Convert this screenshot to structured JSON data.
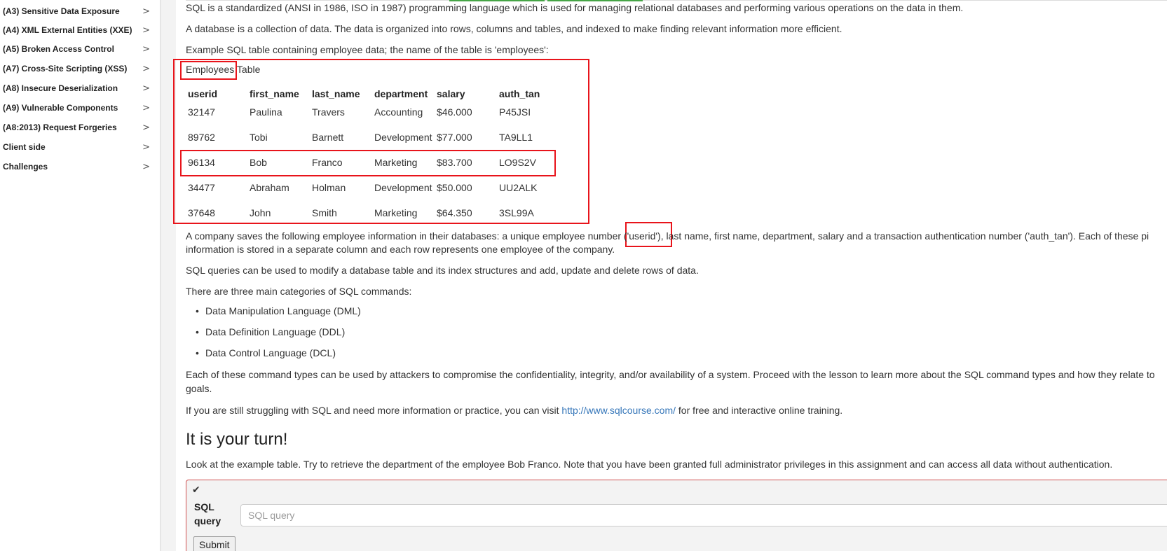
{
  "sidebar": {
    "items": [
      {
        "label": "(A3) Sensitive Data Exposure",
        "chevron": ">"
      },
      {
        "label": "(A4) XML External Entities (XXE)",
        "chevron": ">"
      },
      {
        "label": "(A5) Broken Access Control",
        "chevron": ">"
      },
      {
        "label": "(A7) Cross-Site Scripting (XSS)",
        "chevron": ">"
      },
      {
        "label": "(A8) Insecure Deserialization",
        "chevron": ">"
      },
      {
        "label": "(A9) Vulnerable Components",
        "chevron": ">"
      },
      {
        "label": "(A8:2013) Request Forgeries",
        "chevron": ">"
      },
      {
        "label": "Client side",
        "chevron": ">"
      },
      {
        "label": "Challenges",
        "chevron": ">"
      }
    ]
  },
  "content": {
    "intro1": "SQL is a standardized (ANSI in 1986, ISO in 1987) programming language which is used for managing relational databases and performing various operations on the data in them.",
    "intro2": "A database is a collection of data. The data is organized into rows, columns and tables, and indexed to make finding relevant information more efficient.",
    "intro3": "Example SQL table containing employee data; the name of the table is 'employees':",
    "caption_word": "Employees",
    "caption_rest": " Table",
    "table": {
      "headers": [
        "userid",
        "first_name",
        "last_name",
        "department",
        "salary",
        "auth_tan"
      ],
      "rows": [
        [
          "32147",
          "Paulina",
          "Travers",
          "Accounting",
          "$46.000",
          "P45JSI"
        ],
        [
          "89762",
          "Tobi",
          "Barnett",
          "Development",
          "$77.000",
          "TA9LL1"
        ],
        [
          "96134",
          "Bob",
          "Franco",
          "Marketing",
          "$83.700",
          "LO9S2V"
        ],
        [
          "34477",
          "Abraham",
          "Holman",
          "Development",
          "$50.000",
          "UU2ALK"
        ],
        [
          "37648",
          "John",
          "Smith",
          "Marketing",
          "$64.350",
          "3SL99A"
        ]
      ]
    },
    "company_a": "A company saves the following employee information in their databases: a unique employee number ",
    "company_userid": "('userid')",
    "company_b": ", last name, first name, department, salary and a transaction authentication number ('auth_tan'). Each of these pi",
    "company_line2": "information is stored in a separate column and each row represents one employee of the company.",
    "queries": "SQL queries can be used to modify a database table and its index structures and add, update and delete rows of data.",
    "categories_intro": "There are three main categories of SQL commands:",
    "categories": [
      "Data Manipulation Language (DML)",
      "Data Definition Language (DDL)",
      "Data Control Language (DCL)"
    ],
    "attack_line1": "Each of these command types can be used by attackers to compromise the confidentiality, integrity, and/or availability of a system. Proceed with the lesson to learn more about the SQL command types and how they relate to",
    "attack_line2": "goals.",
    "struggle_a": "If you are still struggling with SQL and need more information or practice, you can visit ",
    "struggle_link": "http://www.sqlcourse.com/",
    "struggle_b": " for free and interactive online training.",
    "turn_heading": "It is your turn!",
    "turn_text": "Look at the example table. Try to retrieve the department of the employee Bob Franco. Note that you have been granted full administrator privileges in this assignment and can access all data without authentication."
  },
  "assignment": {
    "check_icon": "✔",
    "label_line1": "SQL",
    "label_line2": "query",
    "input_placeholder": "SQL query",
    "input_value": "",
    "submit_label": "Submit"
  },
  "colors": {
    "highlight_red": "#e8141b",
    "link_blue": "#3576b9",
    "progress_green": "#46a546"
  }
}
